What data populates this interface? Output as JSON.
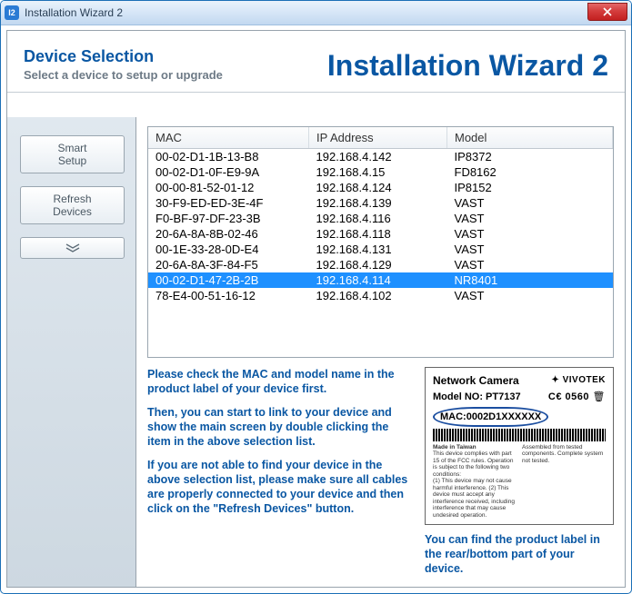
{
  "window": {
    "title": "Installation Wizard 2"
  },
  "header": {
    "title": "Device Selection",
    "subtitle": "Select a device to setup or upgrade",
    "brand": "Installation Wizard 2"
  },
  "sidebar": {
    "smart_setup_l1": "Smart",
    "smart_setup_l2": "Setup",
    "refresh_l1": "Refresh",
    "refresh_l2": "Devices"
  },
  "table": {
    "headers": {
      "mac": "MAC",
      "ip": "IP Address",
      "model": "Model"
    },
    "rows": [
      {
        "mac": "00-02-D1-1B-13-B8",
        "ip": "192.168.4.142",
        "model": "IP8372",
        "selected": false
      },
      {
        "mac": "00-02-D1-0F-E9-9A",
        "ip": "192.168.4.15",
        "model": "FD8162",
        "selected": false
      },
      {
        "mac": "00-00-81-52-01-12",
        "ip": "192.168.4.124",
        "model": "IP8152",
        "selected": false
      },
      {
        "mac": "30-F9-ED-ED-3E-4F",
        "ip": "192.168.4.139",
        "model": "VAST",
        "selected": false
      },
      {
        "mac": "F0-BF-97-DF-23-3B",
        "ip": "192.168.4.116",
        "model": "VAST",
        "selected": false
      },
      {
        "mac": "20-6A-8A-8B-02-46",
        "ip": "192.168.4.118",
        "model": "VAST",
        "selected": false
      },
      {
        "mac": "00-1E-33-28-0D-E4",
        "ip": "192.168.4.131",
        "model": "VAST",
        "selected": false
      },
      {
        "mac": "20-6A-8A-3F-84-F5",
        "ip": "192.168.4.129",
        "model": "VAST",
        "selected": false
      },
      {
        "mac": "00-02-D1-47-2B-2B",
        "ip": "192.168.4.114",
        "model": "NR8401",
        "selected": true
      },
      {
        "mac": "78-E4-00-51-16-12",
        "ip": "192.168.4.102",
        "model": "VAST",
        "selected": false
      }
    ]
  },
  "instructions": {
    "p1": "Please check the MAC and model name in the product label of your device first.",
    "p2": "Then, you can start to link to your device and show the main screen by double clicking the item in the above selection list.",
    "p3": "If you are not able to find your device in the above selection list, please make sure all cables are properly connected to your device and then click on the \"Refresh Devices\" button."
  },
  "product_label": {
    "title": "Network Camera",
    "brand": "VIVOTEK",
    "model_label": "Model NO: PT7137",
    "ce_mark": "C€ 0560",
    "mac": "MAC:0002D1XXXXXX",
    "made": "Made in Taiwan",
    "fine1": "Assembled from tested components. Complete system not tested.",
    "fine2": "This device complies with part 15 of the FCC rules. Operation is subject to the following two conditions:",
    "fine3": "(1) This device may not cause harmful interference. (2) This device must accept any interference received, including interference that may cause undesired operation."
  },
  "label_caption": "You can find the product label in the rear/bottom part of your device."
}
